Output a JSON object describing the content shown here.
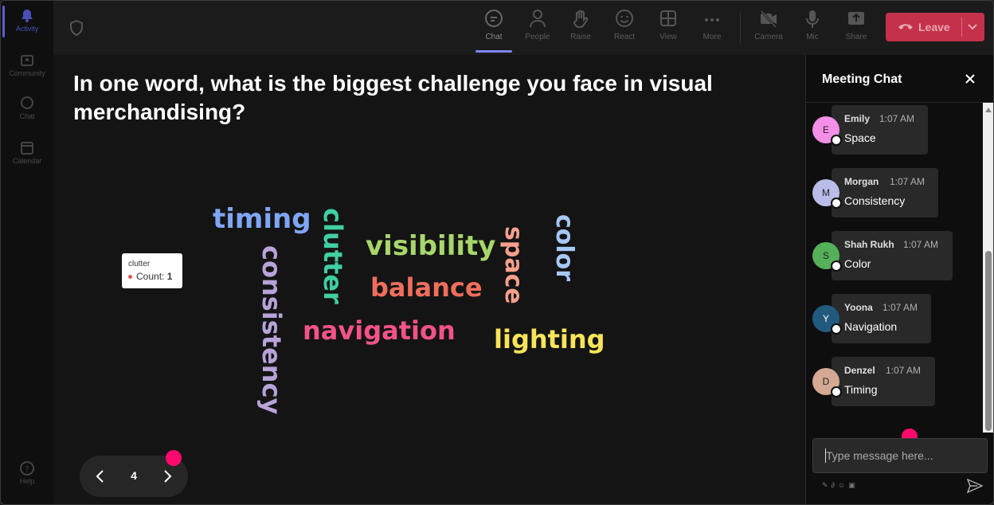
{
  "rail": {
    "items": [
      {
        "label": "Activity",
        "icon": "bell-icon"
      },
      {
        "label": "Community",
        "icon": "community-icon"
      },
      {
        "label": "Chat",
        "icon": "chat-icon"
      },
      {
        "label": "Calendar",
        "icon": "calendar-icon"
      }
    ],
    "help": {
      "label": "Help",
      "icon": "help-icon"
    }
  },
  "toolbar": {
    "buttons": [
      {
        "label": "Chat",
        "icon": "chat-bubble-icon"
      },
      {
        "label": "People",
        "icon": "people-icon"
      },
      {
        "label": "Raise",
        "icon": "hand-icon"
      },
      {
        "label": "React",
        "icon": "smiley-icon"
      },
      {
        "label": "View",
        "icon": "grid-icon"
      },
      {
        "label": "More",
        "icon": "more-icon"
      },
      {
        "label": "Camera",
        "icon": "camera-off-icon"
      },
      {
        "label": "Mic",
        "icon": "mic-icon"
      },
      {
        "label": "Share",
        "icon": "share-icon"
      }
    ],
    "leave_label": "Leave",
    "active": "Chat"
  },
  "main": {
    "question": "In one word, what is the biggest challenge you face in visual merchandising?",
    "words": [
      {
        "text": "timing",
        "color": "#7fa6f5"
      },
      {
        "text": "consistency",
        "color": "#b7a3d9"
      },
      {
        "text": "clutter",
        "color": "#3fcfa2"
      },
      {
        "text": "visibility",
        "color": "#a8d66a"
      },
      {
        "text": "balance",
        "color": "#ef6e5c"
      },
      {
        "text": "navigation",
        "color": "#f4528a"
      },
      {
        "text": "space",
        "color": "#f7a08c"
      },
      {
        "text": "color",
        "color": "#a6c8f8"
      },
      {
        "text": "lighting",
        "color": "#f8e45a"
      }
    ],
    "tooltip": {
      "word": "clutter",
      "count_label": "Count:",
      "count": "1"
    },
    "page_number": "4"
  },
  "chat": {
    "title": "Meeting Chat",
    "messages": [
      {
        "initial": "E",
        "name": "Emily",
        "time": "1:07 AM",
        "text": "Space",
        "avatar_color": "#f48fe8"
      },
      {
        "initial": "M",
        "name": "Morgan",
        "time": "1:07 AM",
        "text": "Consistency",
        "avatar_color": "#b9bde8"
      },
      {
        "initial": "S",
        "name": "Shah Rukh",
        "time": "1:07 AM",
        "text": "Color",
        "avatar_color": "#55b05a"
      },
      {
        "initial": "Y",
        "name": "Yoona",
        "time": "1:07 AM",
        "text": "Navigation",
        "avatar_color": "#225a7e"
      },
      {
        "initial": "D",
        "name": "Denzel",
        "time": "1:07 AM",
        "text": "Timing",
        "avatar_color": "#d4a892"
      }
    ],
    "input_placeholder": "Type message here..."
  }
}
